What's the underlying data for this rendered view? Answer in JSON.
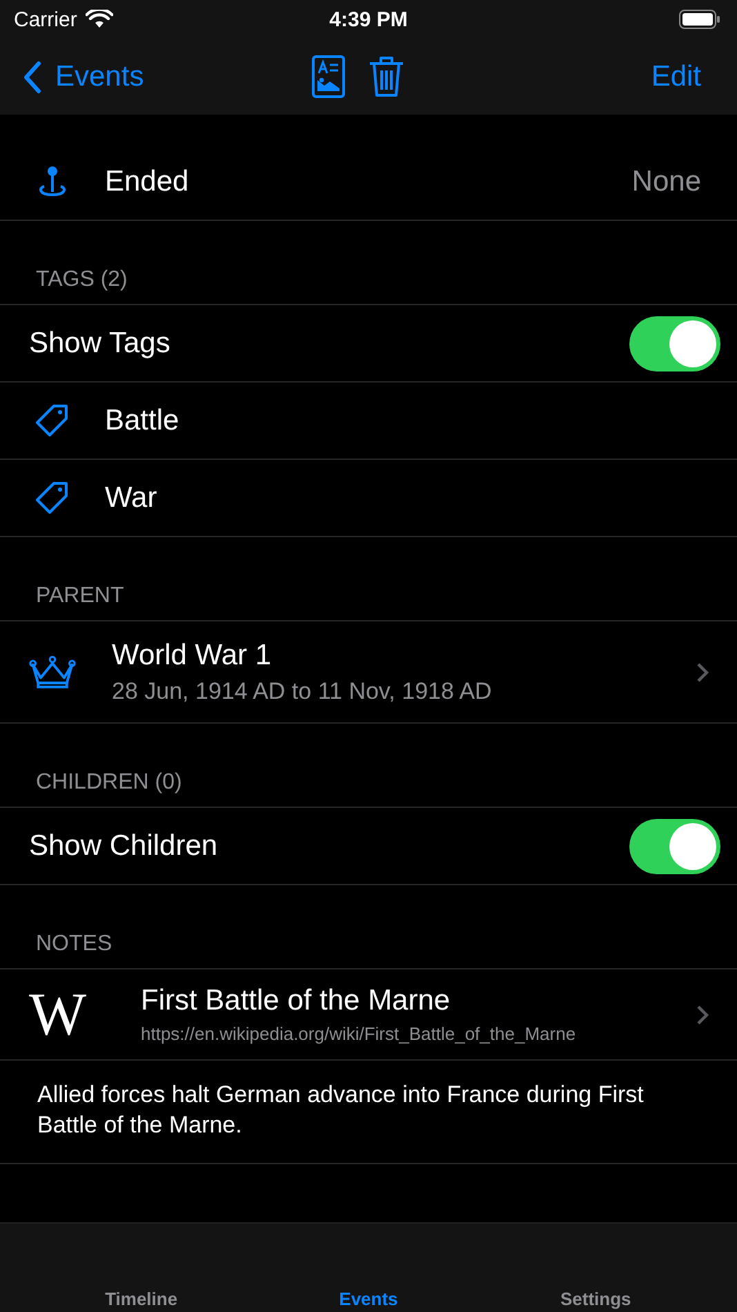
{
  "status_bar": {
    "carrier": "Carrier",
    "time": "4:39 PM"
  },
  "nav_bar": {
    "back": "Events",
    "action": "Edit"
  },
  "rows": [
    {
      "kind": "detail",
      "label": "Ended",
      "value": "None"
    }
  ],
  "sections": [
    {
      "header": "TAGS (2)",
      "toggle": {
        "label": "Show Tags",
        "on": true
      },
      "items": [
        {
          "kind": "tag",
          "label": "Battle"
        },
        {
          "kind": "tag",
          "label": "War"
        }
      ]
    },
    {
      "header": "PARENT",
      "items": [
        {
          "kind": "event",
          "title": "World War 1",
          "subtitle": "28 Jun, 1914 AD to 11 Nov, 1918 AD"
        }
      ]
    },
    {
      "header": "CHILDREN (0)",
      "toggle": {
        "label": "Show Children",
        "on": true
      }
    },
    {
      "header": "NOTES",
      "items": [
        {
          "kind": "link",
          "logo": "W",
          "title": "First Battle of the Marne",
          "url": "https://en.wikipedia.org/wiki/First_Battle_of_the_Marne"
        },
        {
          "kind": "note",
          "text": "Allied forces halt German advance into France during First Battle of the Marne."
        }
      ]
    }
  ],
  "tabs": [
    {
      "label": "Timeline",
      "selected": false
    },
    {
      "label": "Events",
      "selected": true
    },
    {
      "label": "Settings",
      "selected": false
    }
  ]
}
